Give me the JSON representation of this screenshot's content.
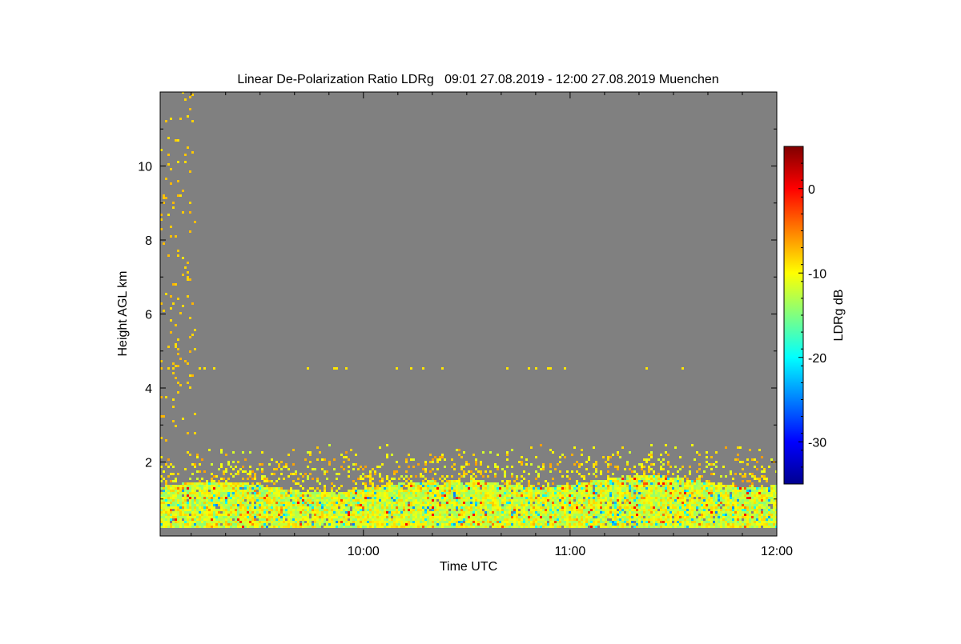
{
  "chart_data": {
    "type": "heatmap",
    "title": "Linear De-Polarization Ratio LDRg   09:01 27.08.2019 - 12:00 27.08.2019 Muenchen",
    "xlabel": "Time UTC",
    "ylabel": "Height AGL km",
    "x_ticks": [
      "10:00",
      "11:00",
      "12:00"
    ],
    "x_tick_values": [
      10.0,
      11.0,
      12.0
    ],
    "xlim": [
      9.0167,
      12.0
    ],
    "y_ticks": [
      "2",
      "4",
      "6",
      "8",
      "10"
    ],
    "y_tick_values": [
      2,
      4,
      6,
      8,
      10
    ],
    "ylim": [
      0,
      12
    ],
    "colorbar": {
      "label": "LDRg dB",
      "ticks": [
        "0",
        "-10",
        "-20",
        "-30"
      ],
      "tick_values": [
        0,
        -10,
        -20,
        -30
      ],
      "range": [
        -35,
        5
      ],
      "colormap": "jet",
      "colors": [
        "#00008f",
        "#0000ff",
        "#0080ff",
        "#00ffff",
        "#80ff80",
        "#ffff00",
        "#ff8000",
        "#ff0000",
        "#800000"
      ]
    },
    "background_color": "#808080",
    "aerosol_layer": {
      "height_range_km": [
        0.2,
        1.3
      ],
      "scatter_top_km": 2.5,
      "typical_ldr_db": [
        -15,
        -8
      ]
    },
    "isolated_layer_km": 4.5
  }
}
